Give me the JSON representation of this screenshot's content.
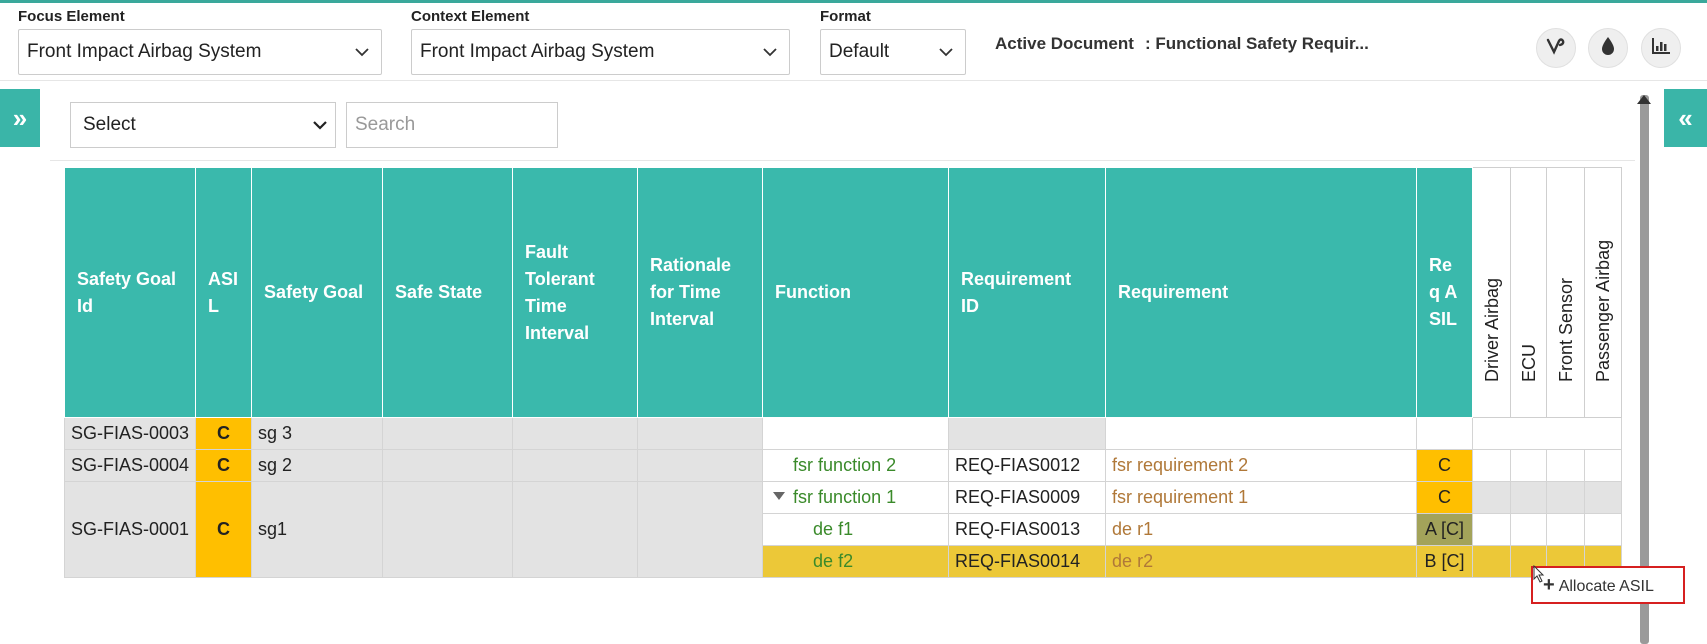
{
  "header": {
    "focus_label": "Focus Element",
    "focus_value": "Front Impact Airbag System",
    "context_label": "Context Element",
    "context_value": "Front Impact Airbag System",
    "format_label": "Format",
    "format_value": "Default",
    "active_doc_label": "Active Document",
    "active_doc_value": ": Functional Safety Requir..."
  },
  "icons": {
    "tool1": "vine-icon",
    "tool2": "drop-icon",
    "tool3": "bar-chart-icon",
    "expand_left": "double-chevron-right-icon",
    "expand_right": "double-chevron-left-icon"
  },
  "filter": {
    "select_value": "Select",
    "search_placeholder": "Search"
  },
  "columns": {
    "sg_id": "Safety Goal Id",
    "asil": "ASIL",
    "safety_goal": "Safety Goal",
    "safe_state": "Safe State",
    "ftti": "Fault Tolerant Time Interval",
    "rationale": "Rationale for Time Interval",
    "function": "Function",
    "req_id": "Requirement ID",
    "requirement": "Requirement",
    "req_asil": "Req ASIL",
    "alloc": [
      "Driver Airbag",
      "ECU",
      "Front Sensor",
      "Passenger Airbag"
    ]
  },
  "rows": {
    "r1": {
      "sg_id": "SG-FIAS-0003",
      "asil": "C",
      "goal": "sg 3"
    },
    "r2": {
      "sg_id": "SG-FIAS-0004",
      "asil": "C",
      "goal": "sg 2",
      "function": "fsr function 2",
      "req_id": "REQ-FIAS0012",
      "requirement": "fsr requirement 2",
      "req_asil": "C"
    },
    "r3": {
      "sg_id": "SG-FIAS-0001",
      "asil": "C",
      "goal": "sg1",
      "sub": [
        {
          "function": "fsr function 1",
          "req_id": "REQ-FIAS0009",
          "requirement": "fsr requirement 1",
          "req_asil": "C"
        },
        {
          "function": "de f1",
          "req_id": "REQ-FIAS0013",
          "requirement": "de r1",
          "req_asil": "A [C]"
        },
        {
          "function": "de f2",
          "req_id": "REQ-FIAS0014",
          "requirement": "de r2",
          "req_asil": "B [C]"
        }
      ]
    }
  },
  "context_menu": {
    "item": "Allocate ASIL"
  },
  "colors": {
    "header_teal": "#3ab9ac",
    "asil_orange": "#ffbf00",
    "highlight_row": "#ecc838",
    "asil_olive": "#a3a35a",
    "menu_border": "#d62020"
  }
}
